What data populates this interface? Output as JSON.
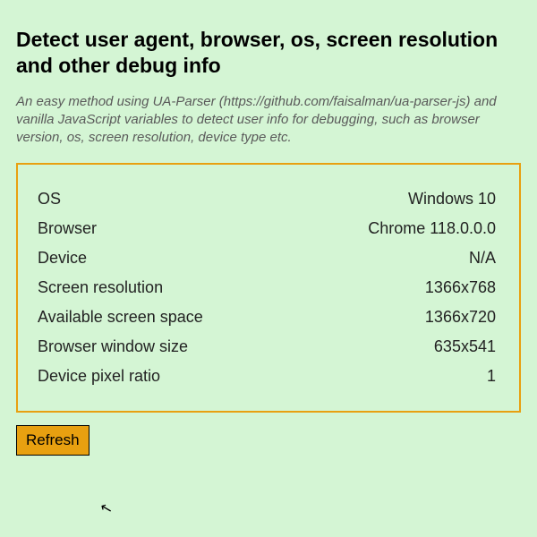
{
  "title": "Detect user agent, browser, os, screen resolution and other debug info",
  "subtitle": "An easy method using UA-Parser (https://github.com/faisalman/ua-parser-js) and vanilla JavaScript variables to detect user info for debugging, such as browser version, os, screen resolution, device type etc.",
  "info": {
    "rows": [
      {
        "label": "OS",
        "value": "Windows 10"
      },
      {
        "label": "Browser",
        "value": "Chrome 118.0.0.0"
      },
      {
        "label": "Device",
        "value": "N/A"
      },
      {
        "label": "Screen resolution",
        "value": "1366x768"
      },
      {
        "label": "Available screen space",
        "value": "1366x720"
      },
      {
        "label": "Browser window size",
        "value": "635x541"
      },
      {
        "label": "Device pixel ratio",
        "value": "1"
      }
    ]
  },
  "refresh_label": "Refresh"
}
